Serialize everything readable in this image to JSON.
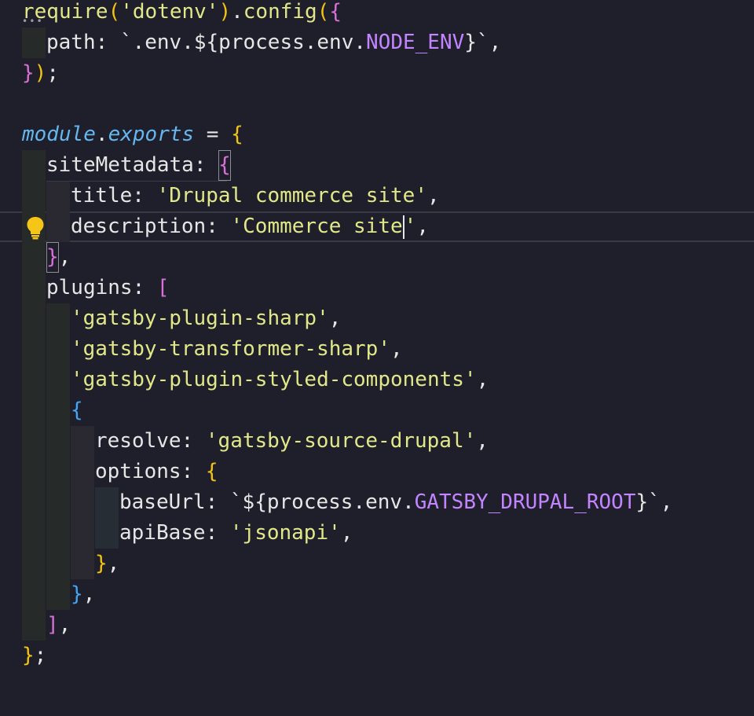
{
  "editor": {
    "language": "javascript",
    "colors": {
      "background": "#1f1f2b",
      "string": "#e2e889",
      "keyword": "#66b7f0",
      "constant": "#c285ff",
      "bracket_level_1": "#f1c40f",
      "bracket_level_2": "#d770d7",
      "bracket_level_3": "#42a5f5"
    },
    "lightbulb_icon": "lightbulb-icon",
    "lines": [
      {
        "text": "require('dotenv').config({"
      },
      {
        "text": "  path: `.env.${process.env.NODE_ENV}`,"
      },
      {
        "text": "});"
      },
      {
        "text": ""
      },
      {
        "text": "module.exports = {"
      },
      {
        "text": "  siteMetadata: {"
      },
      {
        "text": "    title: 'Drupal commerce site',"
      },
      {
        "text": "    description: 'Commerce site',"
      },
      {
        "text": "  },"
      },
      {
        "text": "  plugins: ["
      },
      {
        "text": "    'gatsby-plugin-sharp',"
      },
      {
        "text": "    'gatsby-transformer-sharp',"
      },
      {
        "text": "    'gatsby-plugin-styled-components',"
      },
      {
        "text": "    {"
      },
      {
        "text": "      resolve: 'gatsby-source-drupal',"
      },
      {
        "text": "      options: {"
      },
      {
        "text": "        baseUrl: `${process.env.GATSBY_DRUPAL_ROOT}`,"
      },
      {
        "text": "        apiBase: 'jsonapi',"
      },
      {
        "text": "      },"
      },
      {
        "text": "    },"
      },
      {
        "text": "  ],"
      },
      {
        "text": "};"
      }
    ]
  },
  "tokens": {
    "l1": {
      "a": "require",
      "b": "(",
      "c": "'dotenv'",
      "d": ")",
      "e": ".",
      "f": "config",
      "g": "(",
      "h": "{"
    },
    "l2": {
      "a": "path",
      "b": ": ",
      "c": "`.env.${",
      "d": "process",
      "e": ".",
      "f": "env",
      "g": ".",
      "h": "NODE_ENV",
      "i": "}`",
      "j": ","
    },
    "l3": {
      "a": "}",
      "b": ")",
      "c": ";"
    },
    "l5": {
      "a": "module",
      "b": ".",
      "c": "exports",
      "d": " = ",
      "e": "{"
    },
    "l6": {
      "a": "siteMetadata",
      "b": ": ",
      "c": "{"
    },
    "l7": {
      "a": "title",
      "b": ": ",
      "c": "'Drupal commerce site'",
      "d": ","
    },
    "l8": {
      "a": "description",
      "b": ": ",
      "c": "'Commerce site",
      "d": "'",
      "e": ","
    },
    "l9": {
      "a": "}",
      "b": ","
    },
    "l10": {
      "a": "plugins",
      "b": ": ",
      "c": "["
    },
    "l11": {
      "a": "'gatsby-plugin-sharp'",
      "b": ","
    },
    "l12": {
      "a": "'gatsby-transformer-sharp'",
      "b": ","
    },
    "l13": {
      "a": "'gatsby-plugin-styled-components'",
      "b": ","
    },
    "l14": {
      "a": "{"
    },
    "l15": {
      "a": "resolve",
      "b": ": ",
      "c": "'gatsby-source-drupal'",
      "d": ","
    },
    "l16": {
      "a": "options",
      "b": ": ",
      "c": "{"
    },
    "l17": {
      "a": "baseUrl",
      "b": ": ",
      "c": "`${",
      "d": "process",
      "e": ".",
      "f": "env",
      "g": ".",
      "h": "GATSBY_DRUPAL_ROOT",
      "i": "}`",
      "j": ","
    },
    "l18": {
      "a": "apiBase",
      "b": ": ",
      "c": "'jsonapi'",
      "d": ","
    },
    "l19": {
      "a": "}",
      "b": ","
    },
    "l20": {
      "a": "}",
      "b": ","
    },
    "l21": {
      "a": "]",
      "b": ","
    },
    "l22": {
      "a": "}",
      "b": ";"
    }
  }
}
